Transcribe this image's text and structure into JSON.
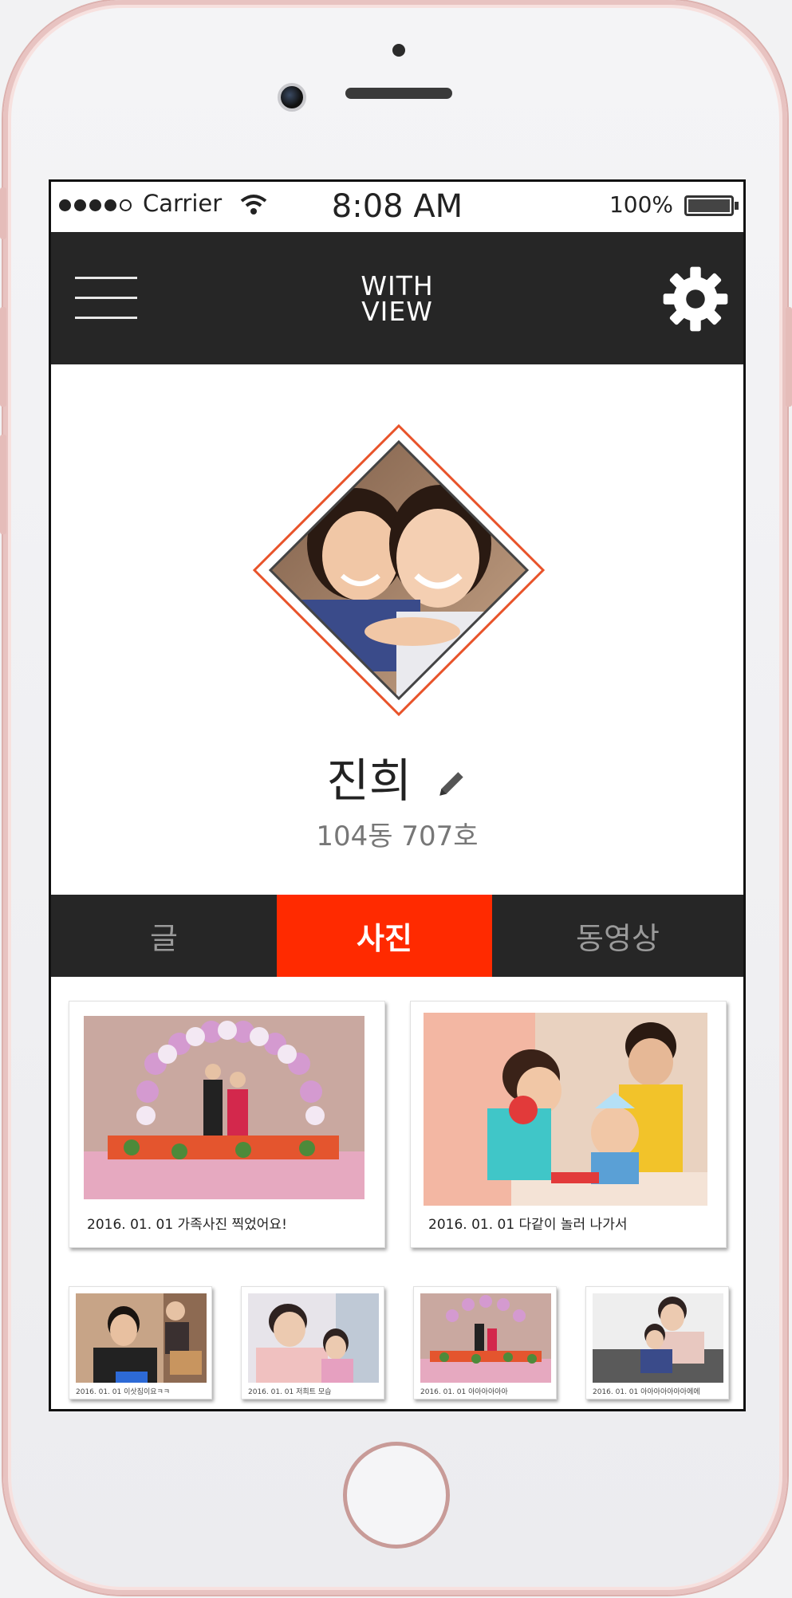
{
  "status_bar": {
    "carrier": "Carrier",
    "time": "8:08 AM",
    "battery": "100%"
  },
  "header": {
    "logo_line1": "WITH",
    "logo_line2": "VIEW"
  },
  "profile": {
    "name": "진희",
    "address": "104동 707호"
  },
  "tabs": [
    {
      "label": "글",
      "active": false
    },
    {
      "label": "사진",
      "active": true
    },
    {
      "label": "동영상",
      "active": false
    }
  ],
  "photos_large": [
    {
      "caption": "2016. 01. 01 가족사진 찍었어요!"
    },
    {
      "caption": "2016. 01. 01 다같이 놀러 나가서"
    }
  ],
  "photos_small": [
    {
      "caption": "2016. 01. 01 이삿짐이요ㅋㅋ"
    },
    {
      "caption": "2016. 01. 01 저희트 모습"
    },
    {
      "caption": "2016. 01. 01 아아아아아아"
    },
    {
      "caption": "2016. 01. 01 아아아아아아아에에"
    }
  ],
  "colors": {
    "accent": "#ff2a00",
    "header_bg": "#262626",
    "phone_frame": "#e8c3c1"
  }
}
